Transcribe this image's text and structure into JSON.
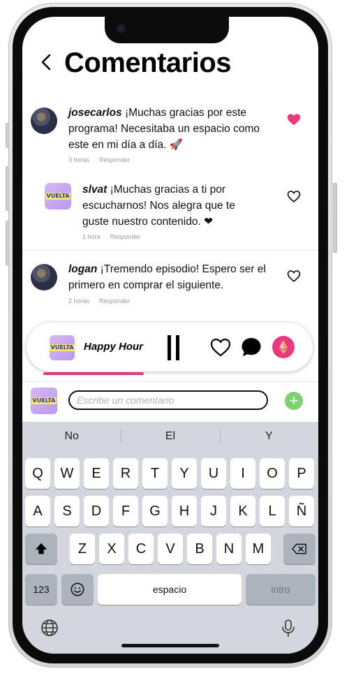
{
  "header": {
    "title": "Comentarios",
    "back_icon": "chevron-left-icon"
  },
  "comments": [
    {
      "user": "josecarlos",
      "text": " ¡Muchas gracias por este programa! Necesitaba un espacio como este en mi día a día. 🚀",
      "time": "3 horas",
      "reply": "Responder",
      "liked": true,
      "avatar": "photo"
    },
    {
      "user": "slvat",
      "text": " ¡Muchas gracias a ti por escucharnos! Nos alegra que te guste nuestro contenido. ❤",
      "time": "1 hora",
      "reply": "Responder",
      "liked": false,
      "avatar": "logo"
    },
    {
      "user": "logan",
      "text": " ¡Tremendo episodio! Espero ser el primero en comprar el siguiente.",
      "time": "2 horas",
      "reply": "Responder",
      "liked": false,
      "avatar": "photo"
    }
  ],
  "logo_text": "VUELTA",
  "player": {
    "title": "Happy Hour",
    "progress": 0.4,
    "icons": [
      "pause-icon",
      "heart-icon",
      "chat-bubble-icon",
      "ethereum-icon"
    ]
  },
  "composer": {
    "placeholder": "Escribe un comentario",
    "value": "",
    "add_icon": "plus-icon"
  },
  "keyboard": {
    "suggestions": [
      "No",
      "El",
      "Y"
    ],
    "row1": [
      "Q",
      "W",
      "E",
      "R",
      "T",
      "Y",
      "U",
      "I",
      "O",
      "P"
    ],
    "row2": [
      "A",
      "S",
      "D",
      "F",
      "G",
      "H",
      "J",
      "K",
      "L",
      "Ñ"
    ],
    "row3": [
      "Z",
      "X",
      "C",
      "V",
      "B",
      "N",
      "M"
    ],
    "numbers_key": "123",
    "space_key": "espacio",
    "return_key": "intro"
  },
  "colors": {
    "accent_pink": "#e8397f",
    "add_green": "#7fd071",
    "keyboard_bg": "#d3d6dd"
  }
}
